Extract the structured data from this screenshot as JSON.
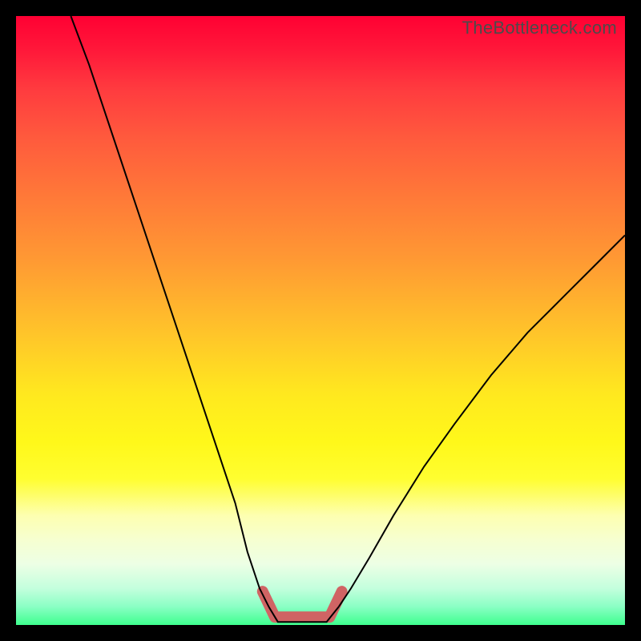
{
  "watermark": "TheBottleneck.com",
  "chart_data": {
    "type": "line",
    "title": "",
    "xlabel": "",
    "ylabel": "",
    "xlim": [
      0,
      100
    ],
    "ylim": [
      0,
      100
    ],
    "grid": false,
    "series": [
      {
        "name": "curve-left",
        "color": "#000000",
        "width": 2,
        "x": [
          9,
          12,
          16,
          20,
          24,
          28,
          32,
          36,
          38,
          40,
          41.5
        ],
        "y": [
          100,
          92,
          80,
          68,
          56,
          44,
          32,
          20,
          12,
          6,
          3
        ]
      },
      {
        "name": "curve-right",
        "color": "#000000",
        "width": 2,
        "x": [
          53,
          55,
          58,
          62,
          67,
          72,
          78,
          84,
          90,
          96,
          100
        ],
        "y": [
          3,
          6,
          11,
          18,
          26,
          33,
          41,
          48,
          54,
          60,
          64
        ]
      },
      {
        "name": "plateau-outline",
        "color": "#000000",
        "width": 2,
        "x": [
          41.5,
          43,
          51,
          53
        ],
        "y": [
          3,
          0.5,
          0.5,
          3
        ]
      },
      {
        "name": "plateau-highlight",
        "color": "#d06464",
        "width": 14,
        "linecap": "round",
        "x": [
          40.5,
          42.5,
          51.5,
          53.5
        ],
        "y": [
          5.5,
          1.3,
          1.3,
          5.5
        ]
      }
    ]
  }
}
